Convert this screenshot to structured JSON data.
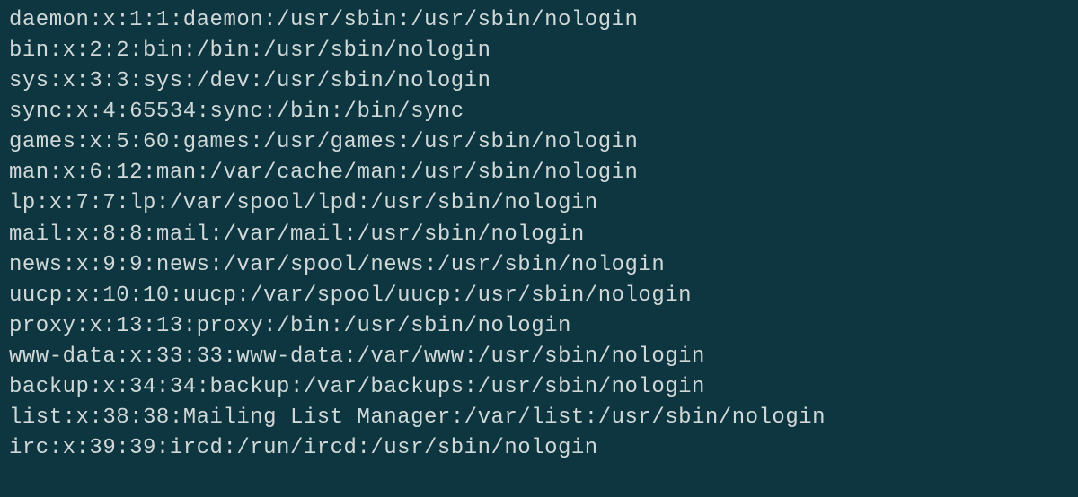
{
  "terminal": {
    "lines": [
      "daemon:x:1:1:daemon:/usr/sbin:/usr/sbin/nologin",
      "bin:x:2:2:bin:/bin:/usr/sbin/nologin",
      "sys:x:3:3:sys:/dev:/usr/sbin/nologin",
      "sync:x:4:65534:sync:/bin:/bin/sync",
      "games:x:5:60:games:/usr/games:/usr/sbin/nologin",
      "man:x:6:12:man:/var/cache/man:/usr/sbin/nologin",
      "lp:x:7:7:lp:/var/spool/lpd:/usr/sbin/nologin",
      "mail:x:8:8:mail:/var/mail:/usr/sbin/nologin",
      "news:x:9:9:news:/var/spool/news:/usr/sbin/nologin",
      "uucp:x:10:10:uucp:/var/spool/uucp:/usr/sbin/nologin",
      "proxy:x:13:13:proxy:/bin:/usr/sbin/nologin",
      "www-data:x:33:33:www-data:/var/www:/usr/sbin/nologin",
      "backup:x:34:34:backup:/var/backups:/usr/sbin/nologin",
      "list:x:38:38:Mailing List Manager:/var/list:/usr/sbin/nologin",
      "irc:x:39:39:ircd:/run/ircd:/usr/sbin/nologin"
    ]
  }
}
